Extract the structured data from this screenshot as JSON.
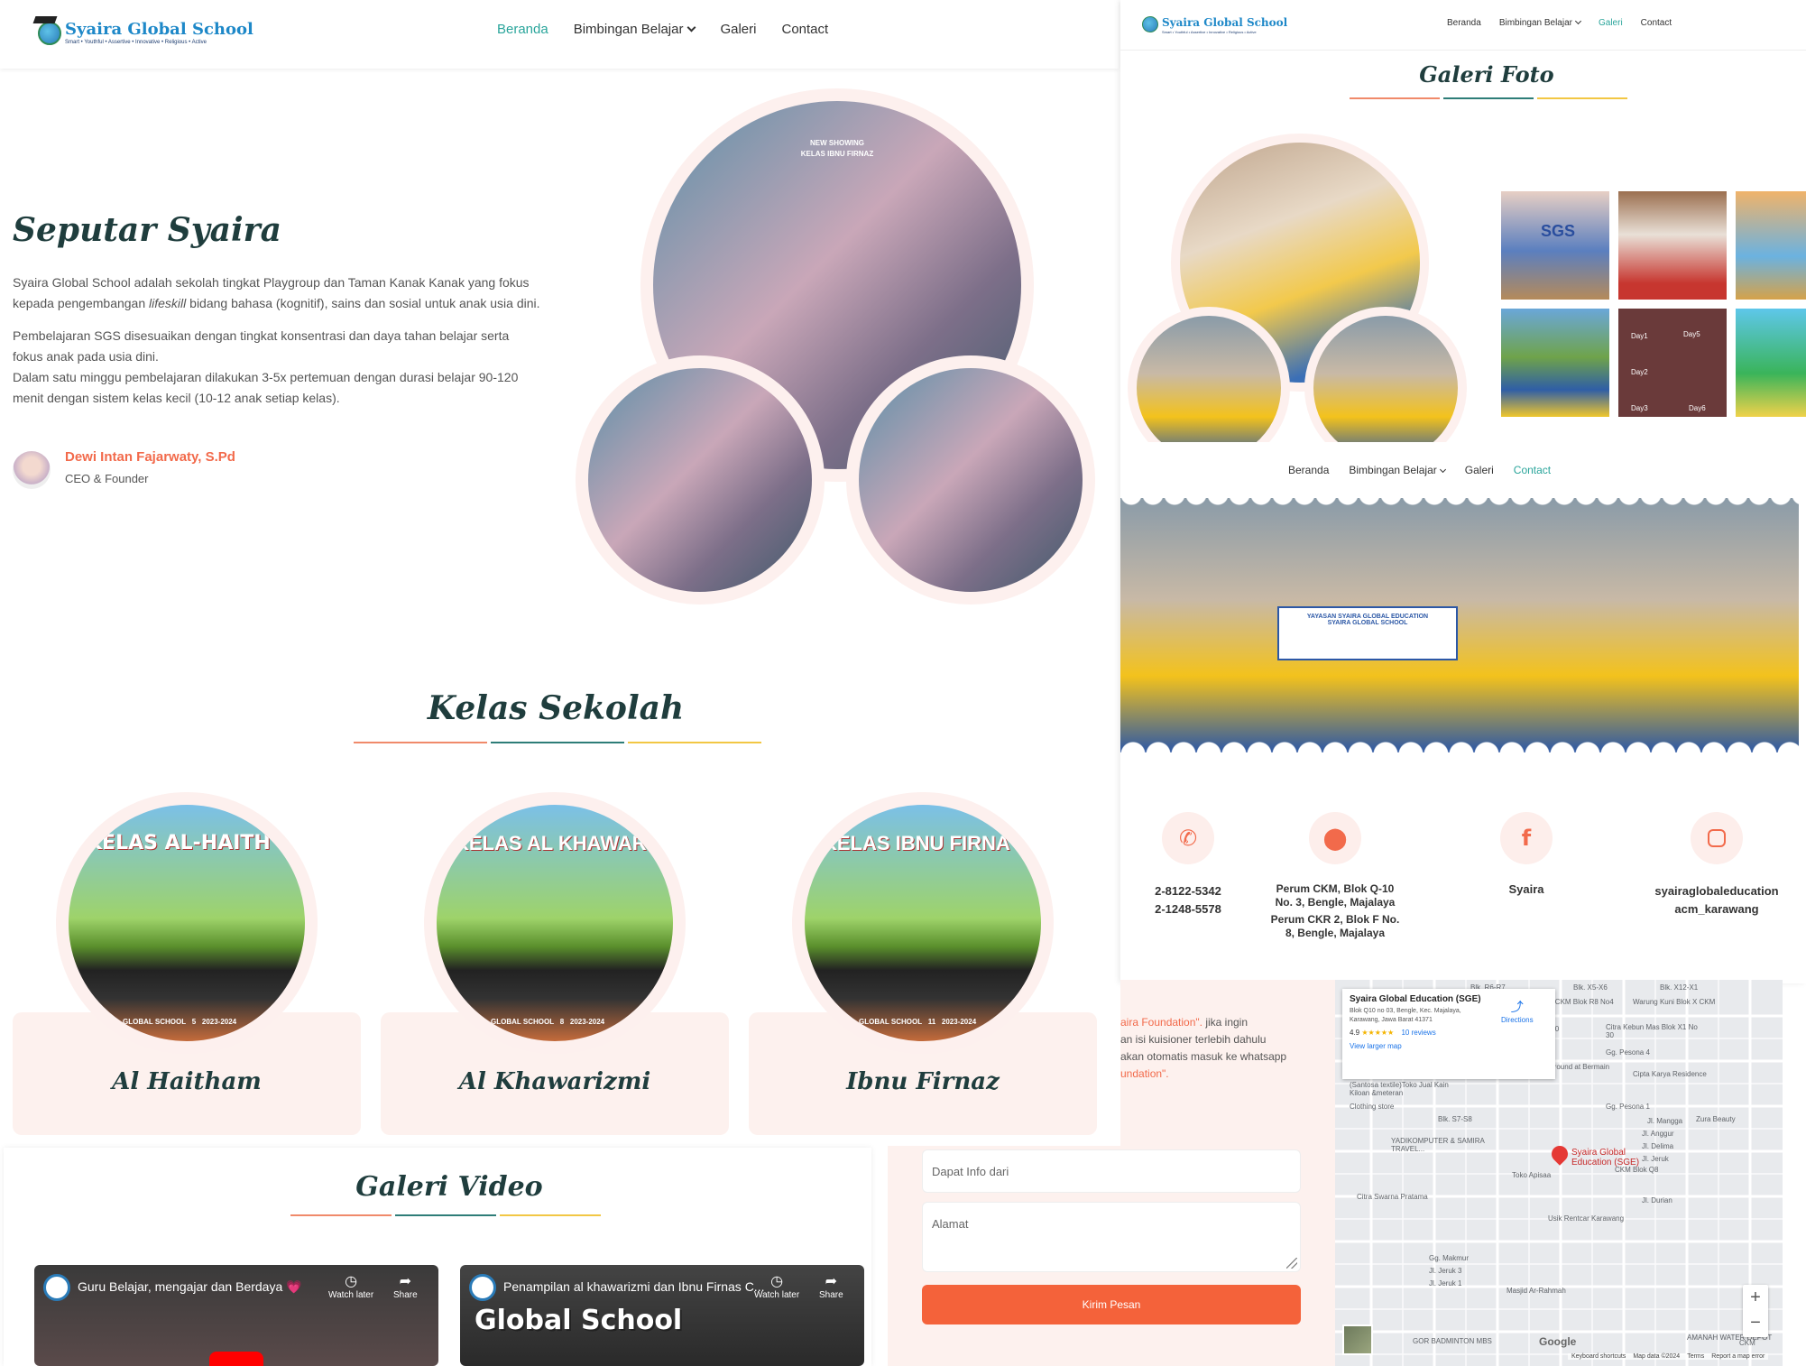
{
  "brand": {
    "name": "Syaira Global School",
    "tagline": "Smart • Youthful • Assertive • Innovative • Religious • Active"
  },
  "nav": {
    "home": "Beranda",
    "study": "Bimbingan Belajar",
    "gallery": "Galeri",
    "contact": "Contact"
  },
  "about": {
    "title": "Seputar Syaira",
    "p1a": "Syaira Global School adalah sekolah tingkat Playgroup dan Taman Kanak Kanak yang fokus kepada pengembangan ",
    "p1em": "lifeskill",
    "p1b": " bidang bahasa (kognitif), sains dan sosial untuk anak usia dini.",
    "p2": "Pembelajaran SGS disesuaikan dengan tingkat konsentrasi dan daya tahan belajar serta fokus anak pada usia dini.",
    "p3": "Dalam satu minggu pembelajaran dilakukan 3-5x pertemuan dengan durasi belajar 90-120 menit dengan sistem kelas kecil (10-12 anak setiap kelas).",
    "founder_name": "Dewi Intan Fajarwaty, S.Pd",
    "founder_role": "CEO & Founder",
    "photo_caption_1": "NEW SHOWING",
    "photo_caption_2": "KELAS IBNU FIRNAZ"
  },
  "classes": {
    "title": "Kelas Sekolah",
    "items": [
      {
        "name": "Al Haitham",
        "banner": "KELAS AL-HAITH",
        "footer": "GLOBAL SCHOOL",
        "num": "5",
        "year": "2023-2024"
      },
      {
        "name": "Al Khawarizmi",
        "banner": "KELAS AL KHAWAR",
        "footer": "GLOBAL SCHOOL",
        "num": "8",
        "year": "2023-2024"
      },
      {
        "name": "Ibnu Firnaz",
        "banner": "KELAS IBNU FIRNA",
        "footer": "GLOBAL SCHOOL",
        "num": "11",
        "year": "2023-2024"
      }
    ]
  },
  "video": {
    "title": "Galeri Video",
    "items": [
      {
        "title": "Guru Belajar, mengajar dan Berdaya 💗",
        "watch": "Watch later",
        "share": "Share",
        "overlay": ""
      },
      {
        "title": "Penampilan al khawarizmi dan Ibnu Firnas C...",
        "watch": "Watch later",
        "share": "Share",
        "overlay": "Global School"
      }
    ]
  },
  "gallery": {
    "title": "Galeri Foto",
    "day_labels": [
      "Day1",
      "Day2",
      "Day3",
      "Day5",
      "Day6"
    ],
    "photo_text": "SGS"
  },
  "banner": {
    "text1": "YAYASAN SYAIRA GLOBAL EDUCATION",
    "text2": "SYAIRA GLOBAL SCHOOL"
  },
  "contact": {
    "phone1": "2-8122-5342",
    "phone2": "2-1248-5578",
    "addr1": "Perum CKM, Blok Q-10 No. 3, Bengle, Majalaya",
    "addr2": "Perum CKR 2, Blok F No. 8, Bengle, Majalaya",
    "facebook": "Syaira",
    "instagram1": "syairaglobaleducation",
    "instagram2": "acm_karawang"
  },
  "form": {
    "note1a": "aira Foundation\".",
    "note1b": " jika ingin",
    "note2": "an isi kuisioner terlebih dahulu",
    "note3": "akan otomatis masuk ke whatsapp",
    "note4": "undation\".",
    "field1": "Dapat Info dari",
    "field2": "Alamat",
    "submit": "Kirim Pesan"
  },
  "map": {
    "place": "Syaira Global Education (SGE)",
    "address": "Blok Q10 no 03, Bengle, Kec. Majalaya, Karawang, Jawa Barat 41371",
    "rating": "4.9",
    "stars": "★★★★★",
    "reviews": "10 reviews",
    "directions": "Directions",
    "larger": "View larger map",
    "pin_label": "Syaira Global Education (SGE)",
    "labels": [
      "Blk. R6-R7",
      "Blk. X5-X6",
      "Blk. X12-X1",
      "Perum CKM Blok R8 No4",
      "Warung Kuni Blok X CKM",
      "Blk. R10",
      "Citra Kebun Mas Blok X1 No 30",
      "Gg. Pesona 4",
      "Cipta Karya Residence",
      "Apisaa Playground at Bermain Anak",
      "(Santosa textile)Toko Jual Kain Kiloan &meteran",
      "Clothing store",
      "Blk. S7-S8",
      "Gg. Pesona 1",
      "Jl. Mangga",
      "Zura Beauty",
      "YADIKOMPUTER & SAMIRA TRAVEL...",
      "Jl. Anggur",
      "Jl. Delima",
      "Jl. Jeruk",
      "Toko Apisaa",
      "CKM Blok Q8",
      "Citra Swarna Pratama",
      "Jl. Durian",
      "Usik Rentcar Karawang",
      "Gg. Makmur",
      "Jl. Jeruk 3",
      "Jl. Jeruk 1",
      "Masjid Ar-Rahmah",
      "GOR BADMINTON MBS",
      "AMANAH WATER DEPOT",
      "CKM"
    ],
    "footer": [
      "Keyboard shortcuts",
      "Map data ©2024",
      "Terms",
      "Report a map error"
    ],
    "zoom_in": "+",
    "zoom_out": "−",
    "google": "Google"
  },
  "colors": {
    "accent": "#f26a4b",
    "teal": "#2aa59b",
    "dark": "#1f3d3d",
    "rule_orange": "#f08a6a",
    "rule_teal": "#2e7d78",
    "rule_yellow": "#f2c744",
    "card": "#fdf1ee"
  }
}
